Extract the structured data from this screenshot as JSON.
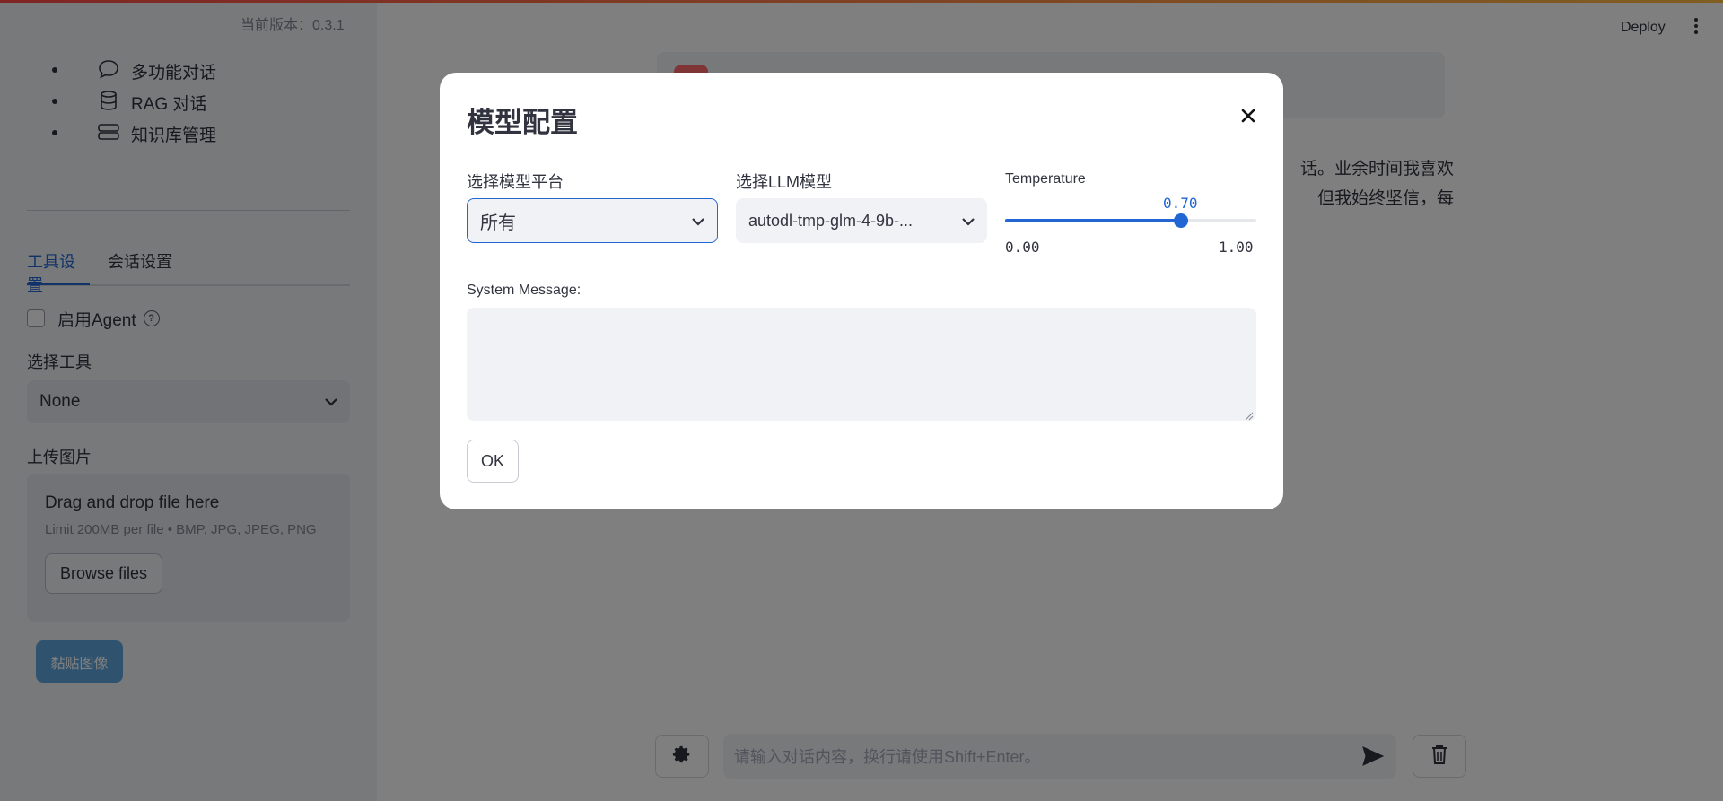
{
  "app": {
    "version_text": "当前版本：0.3.1",
    "deploy_label": "Deploy"
  },
  "sidebar": {
    "nav": [
      {
        "label": "多功能对话",
        "icon": "chat-bubble-icon"
      },
      {
        "label": "RAG 对话",
        "icon": "database-icon"
      },
      {
        "label": "知识库管理",
        "icon": "server-stack-icon"
      }
    ],
    "tabs": [
      {
        "label": "工具设置",
        "active": true
      },
      {
        "label": "会话设置",
        "active": false
      }
    ],
    "agent_checkbox_label": "启用Agent",
    "tool_select_label": "选择工具",
    "tool_select_value": "None",
    "upload_label": "上传图片",
    "uploader": {
      "title": "Drag and drop file here",
      "limit": "Limit 200MB per file • BMP, JPG, JPEG, PNG",
      "browse_label": "Browse files"
    },
    "paste_button_label": "黏贴图像"
  },
  "main": {
    "chat_text_lines": [
      "话。业余时间我喜欢",
      "但我始终坚信，每"
    ],
    "input_placeholder": "请输入对话内容，换行请使用Shift+Enter。"
  },
  "modal": {
    "title": "模型配置",
    "platform_label": "选择模型平台",
    "platform_value": "所有",
    "llm_label": "选择LLM模型",
    "llm_value": "autodl-tmp-glm-4-9b-...",
    "temperature": {
      "label": "Temperature",
      "value": 0.7,
      "value_text": "0.70",
      "min": 0,
      "max": 1,
      "min_text": "0.00",
      "max_text": "1.00"
    },
    "system_message_label": "System Message:",
    "system_message_value": "",
    "ok_label": "OK"
  },
  "colors": {
    "accent": "#2266d4",
    "sidebar_bg": "#f0f2f6",
    "overlay": "rgba(0,0,0,0.5)"
  }
}
